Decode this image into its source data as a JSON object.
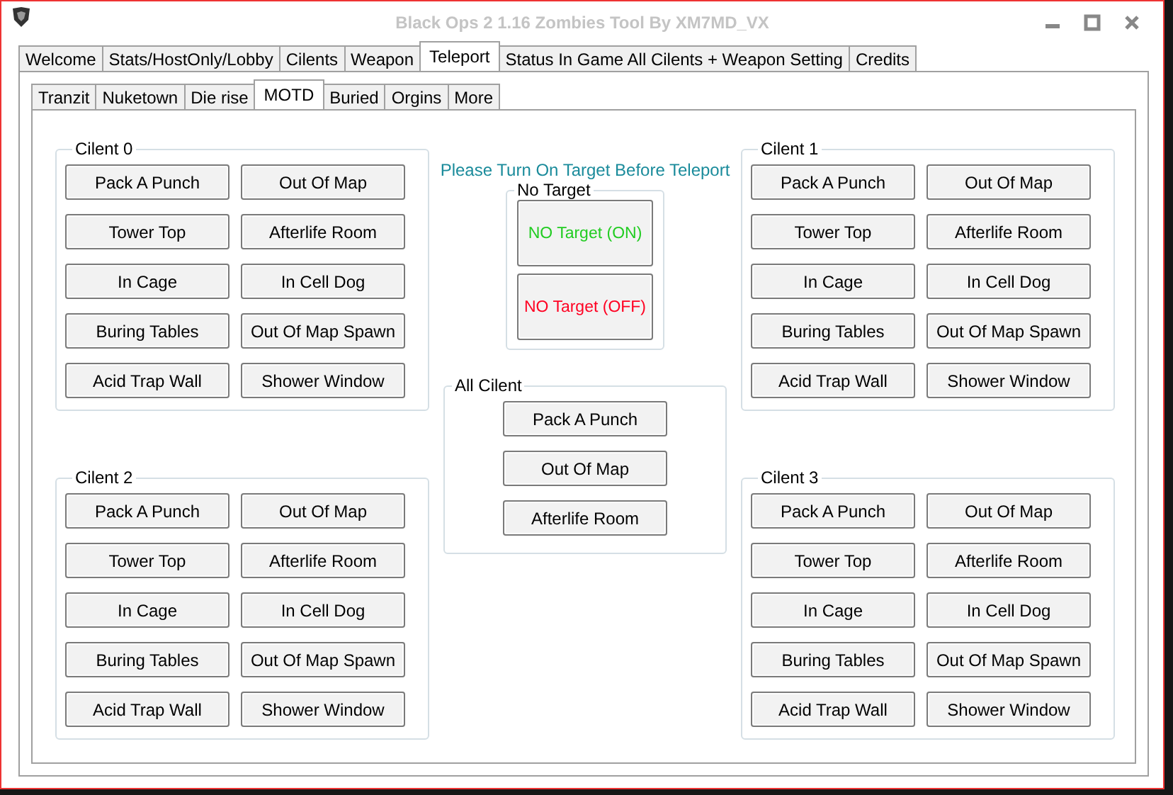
{
  "window": {
    "title": "Black Ops 2 1.16 Zombies Tool By XM7MD_VX"
  },
  "tabs": [
    {
      "label": "Welcome",
      "selected": false
    },
    {
      "label": "Stats/HostOnly/Lobby",
      "selected": false
    },
    {
      "label": "Cilents",
      "selected": false
    },
    {
      "label": "Weapon",
      "selected": false
    },
    {
      "label": "Teleport",
      "selected": true
    },
    {
      "label": "Status In Game All Cilents + Weapon Setting",
      "selected": false
    },
    {
      "label": "Credits",
      "selected": false
    }
  ],
  "subtabs": [
    {
      "label": "Tranzit",
      "selected": false
    },
    {
      "label": "Nuketown",
      "selected": false
    },
    {
      "label": "Die rise",
      "selected": false
    },
    {
      "label": "MOTD",
      "selected": true
    },
    {
      "label": "Buried",
      "selected": false
    },
    {
      "label": "Orgins",
      "selected": false
    },
    {
      "label": "More",
      "selected": false
    }
  ],
  "client_groups": [
    {
      "title": "Cilent 0",
      "buttons": [
        "Pack A Punch",
        "Out Of Map",
        "Tower Top",
        "Afterlife Room",
        "In Cage",
        "In Cell Dog",
        "Buring Tables",
        "Out Of Map Spawn",
        "Acid Trap Wall",
        "Shower Window"
      ]
    },
    {
      "title": "Cilent 1",
      "buttons": [
        "Pack A Punch",
        "Out Of Map",
        "Tower Top",
        "Afterlife Room",
        "In Cage",
        "In Cell Dog",
        "Buring Tables",
        "Out Of Map Spawn",
        "Acid Trap Wall",
        "Shower Window"
      ]
    },
    {
      "title": "Cilent 2",
      "buttons": [
        "Pack A Punch",
        "Out Of Map",
        "Tower Top",
        "Afterlife Room",
        "In Cage",
        "In Cell Dog",
        "Buring Tables",
        "Out Of Map Spawn",
        "Acid Trap Wall",
        "Shower Window"
      ]
    },
    {
      "title": "Cilent 3",
      "buttons": [
        "Pack A Punch",
        "Out Of Map",
        "Tower Top",
        "Afterlife Room",
        "In Cage",
        "In Cell Dog",
        "Buring Tables",
        "Out Of Map Spawn",
        "Acid Trap Wall",
        "Shower Window"
      ]
    }
  ],
  "notice": "Please Turn On Target Before Teleport",
  "no_target": {
    "title": "No Target",
    "buttons": [
      {
        "label": "NO Target (ON)",
        "color": "#22cc22"
      },
      {
        "label": "NO Target (OFF)",
        "color": "#ff0022"
      }
    ]
  },
  "all_client": {
    "title": "All Cilent",
    "buttons": [
      "Pack A Punch",
      "Out Of Map",
      "Afterlife Room"
    ]
  }
}
